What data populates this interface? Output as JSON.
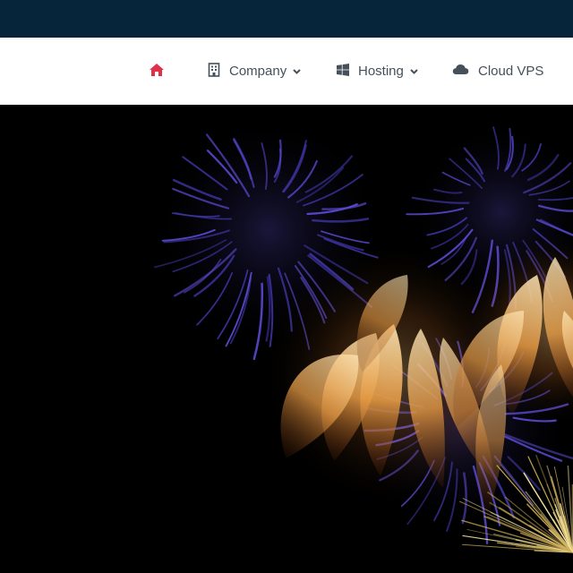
{
  "colors": {
    "top_strip": "#06243a",
    "nav_background": "#ffffff",
    "nav_text": "#45505a",
    "home_accent": "#e0314b",
    "hero_background": "#000000"
  },
  "nav": {
    "home_icon": "home-icon",
    "items": [
      {
        "label": "Company",
        "icon": "building-icon",
        "has_dropdown": true
      },
      {
        "label": "Hosting",
        "icon": "windows-icon",
        "has_dropdown": true
      },
      {
        "label": "Cloud VPS",
        "icon": "cloud-icon",
        "has_dropdown": false
      }
    ]
  },
  "hero": {
    "image": "fireworks-photo"
  }
}
